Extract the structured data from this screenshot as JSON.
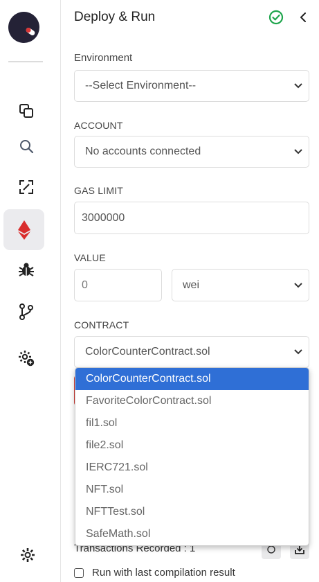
{
  "sidebar": {
    "icons": [
      {
        "name": "file-explorer-icon"
      },
      {
        "name": "search-icon"
      },
      {
        "name": "solidity-compiler-icon"
      },
      {
        "name": "deploy-run-icon",
        "active": true
      },
      {
        "name": "debugger-icon"
      },
      {
        "name": "git-icon"
      },
      {
        "name": "plugin-manager-icon"
      }
    ],
    "settings": "settings-icon"
  },
  "header": {
    "title": "Deploy & Run",
    "status_color": "#1ea54c"
  },
  "environment": {
    "label": "Environment",
    "value": "--Select Environment--"
  },
  "account": {
    "label": "ACCOUNT",
    "value": "No accounts connected"
  },
  "gas_limit": {
    "label": "GAS LIMIT",
    "value": "3000000"
  },
  "value": {
    "label": "VALUE",
    "amount": "0",
    "unit": "wei"
  },
  "contract": {
    "label": "CONTRACT",
    "value": "ColorCounterContract.sol",
    "options": [
      {
        "label": "ColorCounterContract.sol",
        "selected": true
      },
      {
        "label": "FavoriteColorContract.sol",
        "selected": false
      },
      {
        "label": "fil1.sol",
        "selected": false
      },
      {
        "label": "file2.sol",
        "selected": false
      },
      {
        "label": "IERC721.sol",
        "selected": false
      },
      {
        "label": "NFT.sol",
        "selected": false
      },
      {
        "label": "NFTTest.sol",
        "selected": false
      },
      {
        "label": "SafeMath.sol",
        "selected": false
      }
    ]
  },
  "transactions": {
    "recorded_label": "Transactions Recorded : 1",
    "run_last_label": "Run with last compilation result"
  },
  "colors": {
    "accent": "#2f6fd6",
    "danger": "#d23b34",
    "ethereum": "#d92d2d"
  }
}
